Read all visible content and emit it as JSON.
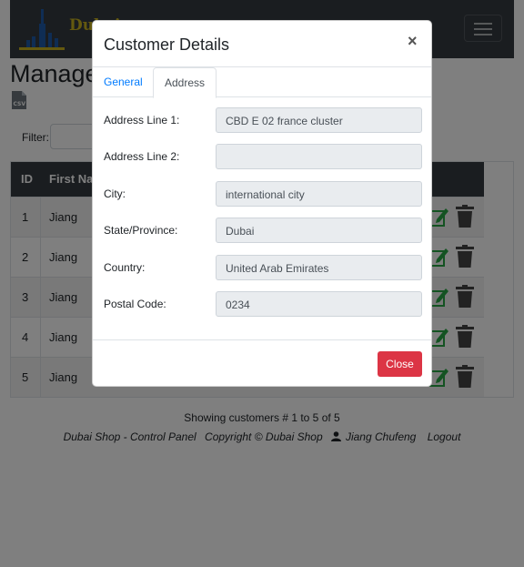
{
  "navbar": {
    "brand_line1": "Dubai",
    "brand_line2": "S",
    "brand_color": "#c8b21e"
  },
  "page": {
    "title": "Manage",
    "csv_icon": "csv-file-icon",
    "filter_label": "Filter:"
  },
  "table": {
    "headers": [
      "ID",
      "First Name"
    ],
    "rows": [
      {
        "id": "1",
        "first_name": "Jiang"
      },
      {
        "id": "2",
        "first_name": "Jiang"
      },
      {
        "id": "3",
        "first_name": "Jiang"
      },
      {
        "id": "4",
        "first_name": "Jiang"
      },
      {
        "id": "5",
        "first_name": "Jiang"
      }
    ],
    "edit_icon": "edit-icon",
    "delete_icon": "trash-icon",
    "edit_color": "#28a745",
    "delete_color": "#444444"
  },
  "summary": {
    "showing": "Showing customers # 1 to 5 of 5"
  },
  "footer": {
    "control_panel": "Dubai Shop - Control Panel",
    "copyright": "Copyright © Dubai Shop",
    "user": "Jiang Chufeng",
    "logout": "Logout"
  },
  "modal": {
    "title": "Customer Details",
    "close_x": "×",
    "tabs": [
      {
        "label": "General",
        "active": false
      },
      {
        "label": "Address",
        "active": true
      }
    ],
    "fields": [
      {
        "label": "Address Line 1:",
        "value": "CBD E 02 france cluster"
      },
      {
        "label": "Address Line 2:",
        "value": ""
      },
      {
        "label": "City:",
        "value": "international city"
      },
      {
        "label": "State/Province:",
        "value": "Dubai"
      },
      {
        "label": "Country:",
        "value": "United Arab Emirates"
      },
      {
        "label": "Postal Code:",
        "value": "0234"
      }
    ],
    "close_button": "Close",
    "close_button_color": "#dc3545",
    "link_color": "#007bff"
  }
}
